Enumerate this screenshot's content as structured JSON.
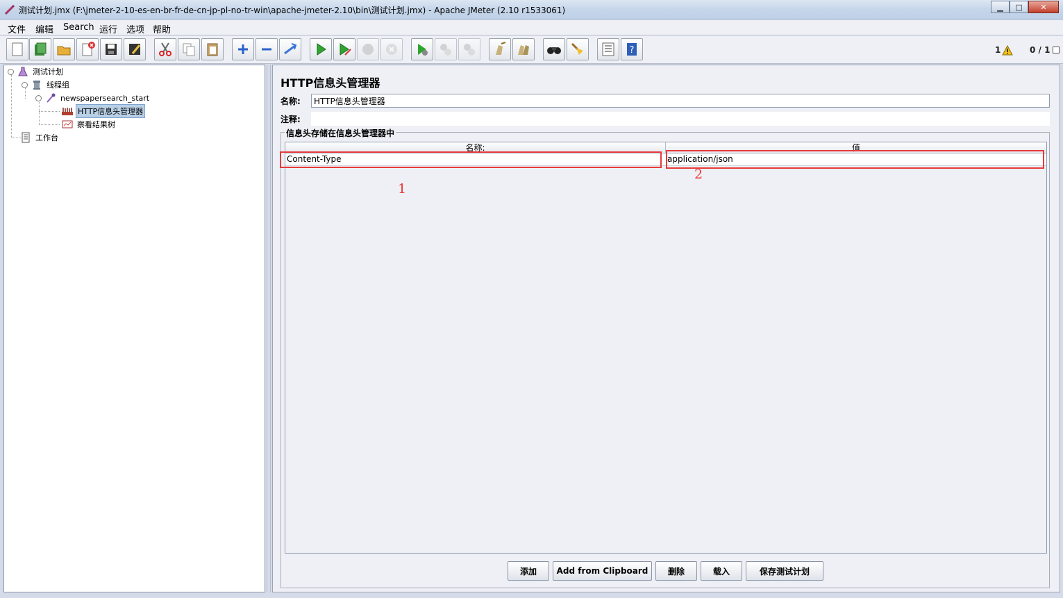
{
  "window": {
    "title": "测试计划.jmx (F:\\jmeter-2-10-es-en-br-fr-de-cn-jp-pl-no-tr-win\\apache-jmeter-2.10\\bin\\测试计划.jmx) - Apache JMeter (2.10 r1533061)",
    "minimize": "▁",
    "maximize": "□",
    "close": "✕"
  },
  "menu": [
    "文件",
    "编辑",
    "Search",
    "运行",
    "选项",
    "帮助"
  ],
  "toolbar": {
    "icons": [
      "new-icon",
      "templates-icon",
      "open-icon",
      "close-file-icon",
      "save-icon",
      "save-as-icon",
      "cut-icon",
      "copy-icon",
      "paste-icon",
      "expand-icon",
      "collapse-icon",
      "toggle-icon",
      "start-icon",
      "start-no-pause-icon",
      "stop-icon",
      "shutdown-icon",
      "remote-start-icon",
      "remote-stop-icon",
      "remote-shutdown-icon",
      "clear-icon",
      "clear-all-icon",
      "search-icon",
      "reset-search-icon",
      "function-helper-icon",
      "help-icon"
    ],
    "warning_count": "1",
    "thread_count": "0 / 1"
  },
  "tree": {
    "nodes": [
      {
        "label": "测试计划"
      },
      {
        "label": "线程组"
      },
      {
        "label": "newspapersearch_start"
      },
      {
        "label": "HTTP信息头管理器"
      },
      {
        "label": "察看结果树"
      },
      {
        "label": "工作台"
      }
    ]
  },
  "panel": {
    "title": "HTTP信息头管理器",
    "name_label": "名称:",
    "name_value": "HTTP信息头管理器",
    "comment_label": "注释:",
    "comment_value": "",
    "group_title": "信息头存储在信息头管理器中",
    "columns": [
      "名称:",
      "值"
    ],
    "rows": [
      [
        "Content-Type",
        "application/json"
      ]
    ],
    "annotations": [
      "1",
      "2"
    ],
    "buttons": [
      "添加",
      "Add from Clipboard",
      "删除",
      "载入",
      "保存测试计划"
    ]
  },
  "colors": {
    "annotation": "#e83a3a",
    "selection": "#b8cfe5"
  }
}
